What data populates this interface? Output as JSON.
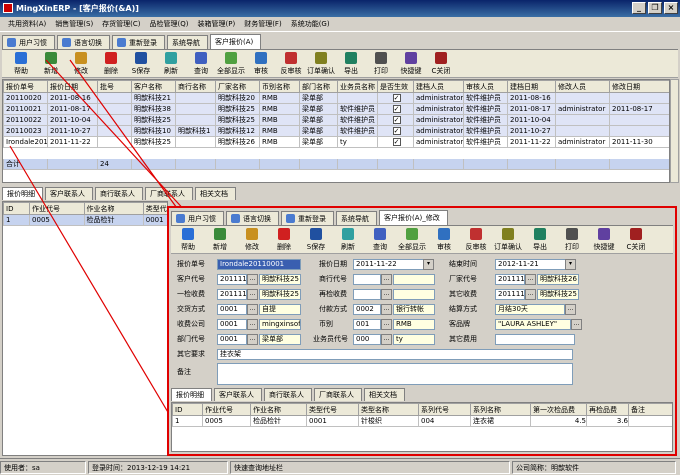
{
  "window": {
    "title": "MingXinERP - [客户报价(&A)]"
  },
  "menu": [
    "共用资料(A)",
    "销售管理(S)",
    "存货管理(C)",
    "品检管理(Q)",
    "装箱管理(P)",
    "财务管理(F)",
    "系统功能(G)"
  ],
  "tabs": [
    {
      "label": "用户习惯",
      "icon": "user-icon"
    },
    {
      "label": "语言切换",
      "icon": "language-icon"
    },
    {
      "label": "重新登录",
      "icon": "login-icon"
    },
    {
      "label": "系统导航",
      "icon": ""
    },
    {
      "label": "客户报价(A)",
      "icon": ""
    }
  ],
  "toolbar": [
    {
      "label": "帮助",
      "icon": "help-icon",
      "color": "#2a6fd6"
    },
    {
      "label": "新增",
      "icon": "add-icon",
      "color": "#3a8a3a"
    },
    {
      "label": "修改",
      "icon": "edit-icon",
      "color": "#c89020"
    },
    {
      "label": "删除",
      "icon": "delete-icon",
      "color": "#d02020"
    },
    {
      "label": "S保存",
      "icon": "save-icon",
      "color": "#2050a0"
    },
    {
      "label": "刷新",
      "icon": "refresh-icon",
      "color": "#30a0a0"
    },
    {
      "label": "查询",
      "icon": "query-icon",
      "color": "#4060c0"
    },
    {
      "label": "全部显示",
      "icon": "show-all-icon",
      "color": "#50a040"
    },
    {
      "label": "审核",
      "icon": "approve-icon",
      "color": "#3070c0"
    },
    {
      "label": "反审核",
      "icon": "unapprove-icon",
      "color": "#c03030"
    },
    {
      "label": "订单确认",
      "icon": "order-confirm-icon",
      "color": "#808020"
    },
    {
      "label": "导出",
      "icon": "export-icon",
      "color": "#208060"
    },
    {
      "label": "打印",
      "icon": "print-icon",
      "color": "#505050"
    },
    {
      "label": "快捷键",
      "icon": "shortcut-icon",
      "color": "#6040a0"
    },
    {
      "label": "C关闭",
      "icon": "close-icon",
      "color": "#a02020"
    }
  ],
  "main_grid": {
    "columns": [
      "报价单号",
      "报价日期",
      "批号",
      "客户名称",
      "商行名称",
      "厂家名称",
      "币别名称",
      "部门名称",
      "业务员名称",
      "是否生效",
      "建档人员",
      "审核人员",
      "建档日期",
      "修改人员",
      "修改日期"
    ],
    "rows": [
      [
        "20110020",
        "2011-08-16",
        "",
        "明歆科技21",
        "",
        "明歆科技20",
        "RMB",
        "梁单部",
        "",
        "✓",
        "administrator",
        "软件维护员",
        "2011-08-16",
        "",
        ""
      ],
      [
        "20110021",
        "2011-08-17",
        "",
        "明歆科技38",
        "",
        "明歆科技25",
        "RMB",
        "梁单部",
        "软件维护员",
        "✓",
        "administrator",
        "软件维护员",
        "2011-08-17",
        "administrator",
        "2011-08-17"
      ],
      [
        "20110022",
        "2011-10-04",
        "",
        "明歆科技25",
        "",
        "明歆科技25",
        "RMB",
        "梁单部",
        "软件维护员",
        "✓",
        "administrator",
        "软件维护员",
        "2011-10-04",
        "",
        ""
      ],
      [
        "20110023",
        "2011-10-27",
        "",
        "明歆科技10",
        "明歆科技1",
        "明歆科技12",
        "RMB",
        "梁单部",
        "软件维护员",
        "✓",
        "administrator",
        "软件维护员",
        "2011-10-27",
        "",
        ""
      ],
      [
        "Irondale2011",
        "2011-11-22",
        "",
        "明歆科技25",
        "",
        "明歆科技26",
        "RMB",
        "梁单部",
        "ty",
        "✓",
        "administrator",
        "软件维护员",
        "2011-11-22",
        "administrator",
        "2011-11-30"
      ]
    ],
    "total_label": "合计",
    "total_count": "24"
  },
  "detail_tabs": [
    "报价明细",
    "客户联系人",
    "商行联系人",
    "厂商联系人",
    "相关文档"
  ],
  "detail_grid": {
    "columns": [
      "ID",
      "作业代号",
      "作业名称",
      "类型代号"
    ],
    "rows": [
      [
        "1",
        "0005",
        "检品检针",
        "0001"
      ]
    ]
  },
  "overlay": {
    "tabs": [
      {
        "label": "用户习惯",
        "icon": "user-icon"
      },
      {
        "label": "语言切换",
        "icon": "language-icon"
      },
      {
        "label": "重新登录",
        "icon": "login-icon"
      },
      {
        "label": "系统导航",
        "icon": ""
      },
      {
        "label": "客户报价(A)_修改",
        "icon": ""
      }
    ],
    "toolbar": [
      {
        "label": "帮助",
        "icon": "help-icon",
        "color": "#2a6fd6"
      },
      {
        "label": "新增",
        "icon": "add-icon",
        "color": "#3a8a3a"
      },
      {
        "label": "修改",
        "icon": "edit-icon",
        "color": "#c89020"
      },
      {
        "label": "删除",
        "icon": "delete-icon",
        "color": "#d02020"
      },
      {
        "label": "S保存",
        "icon": "save-icon",
        "color": "#2050a0"
      },
      {
        "label": "刷新",
        "icon": "refresh-icon",
        "color": "#30a0a0"
      },
      {
        "label": "查询",
        "icon": "query-icon",
        "color": "#4060c0"
      },
      {
        "label": "全部显示",
        "icon": "show-all-icon",
        "color": "#50a040"
      },
      {
        "label": "审核",
        "icon": "approve-icon",
        "color": "#3070c0"
      },
      {
        "label": "反审核",
        "icon": "unapprove-icon",
        "color": "#c03030"
      },
      {
        "label": "订单确认",
        "icon": "order-confirm-icon",
        "color": "#808020"
      },
      {
        "label": "导出",
        "icon": "export-icon",
        "color": "#208060"
      },
      {
        "label": "打印",
        "icon": "print-icon",
        "color": "#505050"
      },
      {
        "label": "快捷键",
        "icon": "shortcut-icon",
        "color": "#6040a0"
      },
      {
        "label": "C关闭",
        "icon": "close-icon",
        "color": "#a02020"
      }
    ],
    "form": {
      "quote_no_label": "报价单号",
      "quote_no": "Irondale20110001",
      "quote_date_label": "报价日期",
      "quote_date": "2011-11-22",
      "end_date_label": "结束时间",
      "end_date": "2012-11-21",
      "customer_code_label": "客户代号",
      "customer_code": "201111",
      "customer_name": "明歆科技25",
      "firm_code_label": "商行代号",
      "firm_code": "",
      "factory_code_label": "厂家代号",
      "factory_code": "201111",
      "factory_name": "明歆科技26",
      "first_fee_label": "一检收费",
      "first_fee_code": "201111",
      "first_fee_name": "明歆科技25",
      "re_fee_label": "再检收费",
      "re_fee_code": "",
      "re_fee_name": "",
      "other_fee_label": "其它收费",
      "other_fee_code": "201111",
      "other_fee_name": "明歆科技25",
      "trade_label": "交货方式",
      "trade_code": "0001",
      "trade_name": "自提",
      "pay_label": "付款方式",
      "pay_code": "0002",
      "pay_name": "银行转帐",
      "settle_label": "结算方式",
      "settle_name": "月结30天",
      "collect_label": "收费公司",
      "collect_code": "0001",
      "collect_name": "mingxinsoft",
      "currency_label": "币别",
      "currency_code": "001",
      "currency_name": "RMB",
      "brand_label": "客品牌",
      "brand_name": "\"LAURA ASHLEY\"",
      "dept_label": "部门代号",
      "dept_code": "0001",
      "dept_name": "梁单部",
      "sales_label": "业务员代号",
      "sales_code": "000",
      "sales_name": "ty",
      "other_cost_label": "其它费用",
      "other_cost": "",
      "other_req_label": "其它要求",
      "other_req": "挂衣架",
      "remark_label": "备注",
      "remark": ""
    },
    "detail_tabs": [
      "报价明细",
      "客户联系人",
      "商行联系人",
      "厂商联系人",
      "相关文档"
    ],
    "detail_grid": {
      "columns": [
        "ID",
        "作业代号",
        "作业名称",
        "类型代号",
        "类型名称",
        "系列代号",
        "系列名称",
        "第一次检品费",
        "再检品费",
        "备注"
      ],
      "rows": [
        [
          "1",
          "0005",
          "检品检针",
          "0001",
          "针梭织",
          "004",
          "连衣裙",
          "4.5",
          "3.6",
          ""
        ]
      ]
    }
  },
  "statusbar": {
    "user": "使用者：sa",
    "login_time": "登录时间：2013-12-19 14:21",
    "quick_query": "快速查询地址栏",
    "company": "公司简称：明歆软件"
  }
}
